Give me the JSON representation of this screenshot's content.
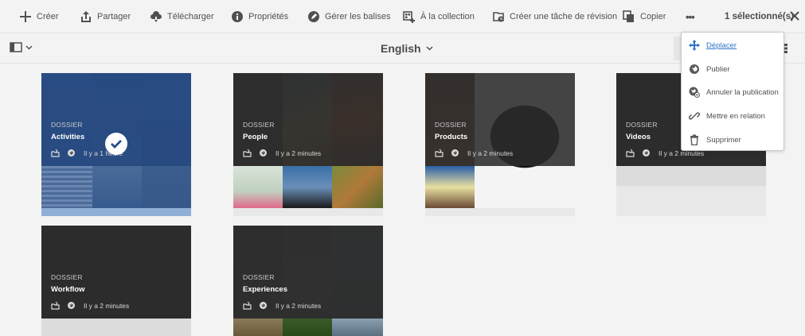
{
  "toolbar": {
    "create": "Créer",
    "share": "Partager",
    "download": "Télécharger",
    "properties": "Propriétés",
    "manage_tags": "Gérer les balises",
    "to_collection": "À la collection",
    "create_review_task": "Créer une tâche de révision",
    "copy": "Copier",
    "more": "•••",
    "selection_count": "1 sélectionné(s)"
  },
  "subbar": {
    "language": "English"
  },
  "menu": {
    "items": [
      {
        "label": "Déplacer",
        "icon": "move-icon"
      },
      {
        "label": "Publier",
        "icon": "globe-icon"
      },
      {
        "label": "Annuler la publication",
        "icon": "unpublish-globe-icon"
      },
      {
        "label": "Mettre en relation",
        "icon": "link-icon"
      },
      {
        "label": "Supprimer",
        "icon": "trash-icon"
      }
    ]
  },
  "cards": [
    {
      "type": "DOSSIER",
      "title": "Activities",
      "time": "Il y a 1 heure",
      "selected": true
    },
    {
      "type": "DOSSIER",
      "title": "People",
      "time": "Il y a 2 minutes",
      "selected": false
    },
    {
      "type": "DOSSIER",
      "title": "Products",
      "time": "Il y a 2 minutes",
      "selected": false
    },
    {
      "type": "DOSSIER",
      "title": "Videos",
      "time": "Il y a 2 minutes",
      "selected": false
    },
    {
      "type": "DOSSIER",
      "title": "Workflow",
      "time": "Il y a 2 minutes",
      "selected": false
    },
    {
      "type": "DOSSIER",
      "title": "Experiences",
      "time": "Il y a 2 minutes",
      "selected": false
    }
  ],
  "colors": {
    "selected_overlay": "#264880",
    "link_blue": "#2d73c9",
    "card_overlay": "#2b2b2b"
  }
}
